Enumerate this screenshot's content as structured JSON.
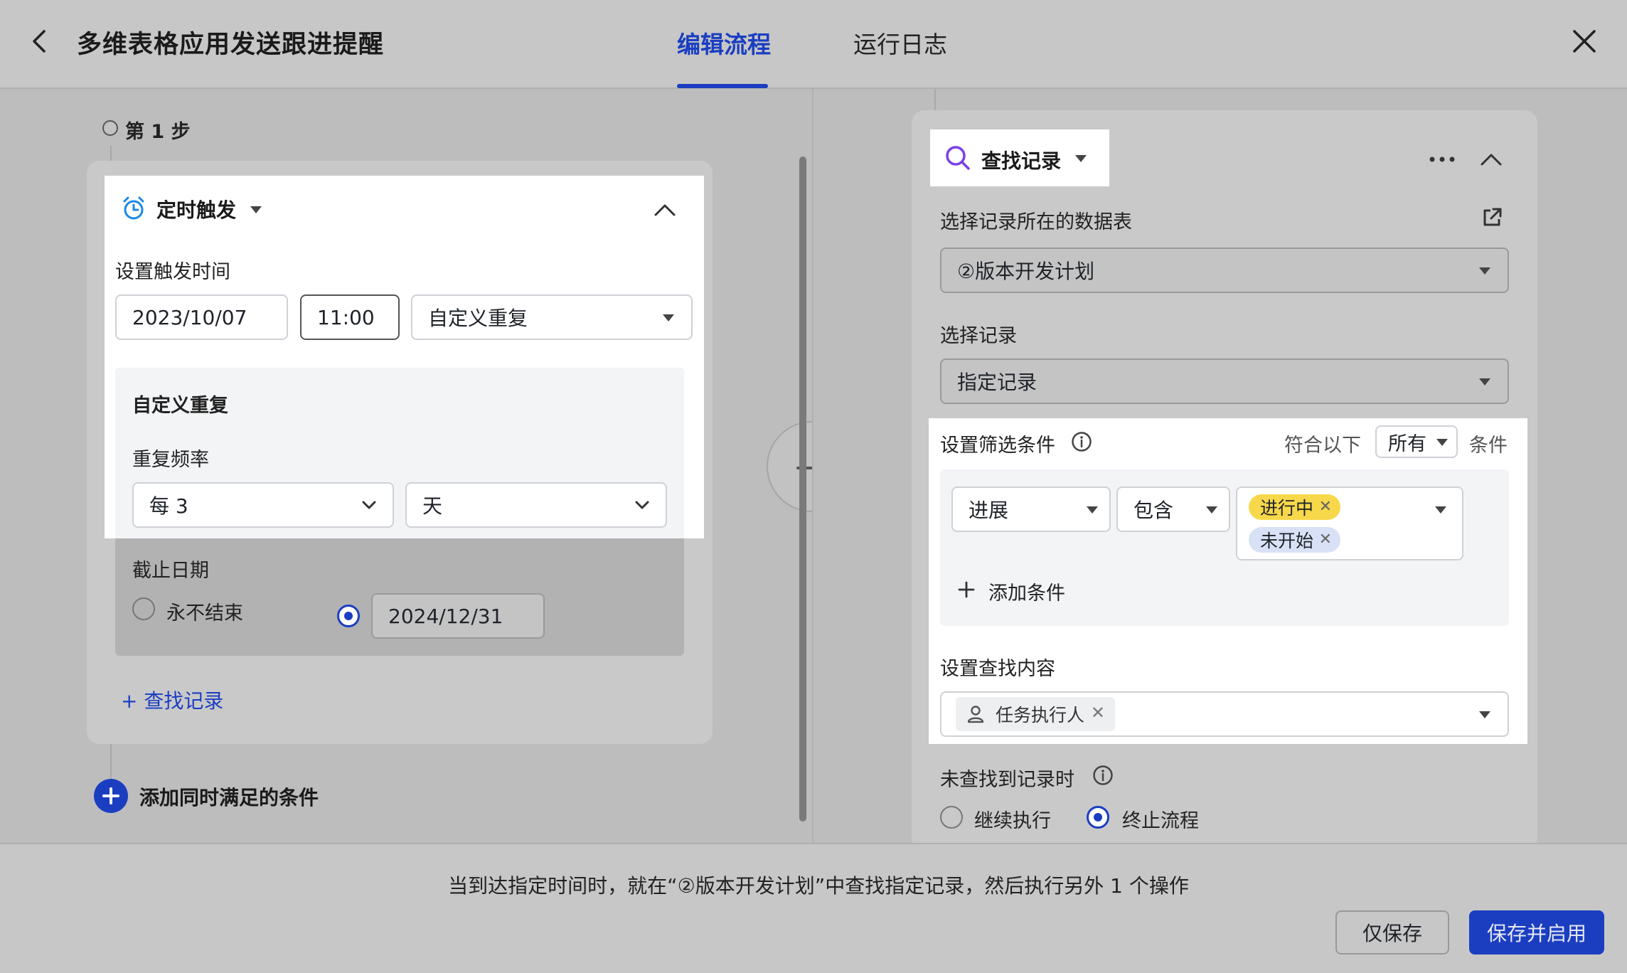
{
  "header": {
    "title": "多维表格应用发送跟进提醒",
    "tabs": [
      {
        "label": "编辑流程",
        "active": true
      },
      {
        "label": "运行日志",
        "active": false
      }
    ]
  },
  "left": {
    "step_label": "第 1 步",
    "trigger": {
      "title": "定时触发",
      "time_label": "设置触发时间",
      "date": "2023/10/07",
      "time": "11:00",
      "repeat_select": "自定义重复",
      "custom": {
        "heading": "自定义重复",
        "freq_label": "重复频率",
        "every": "每 3",
        "unit": "天",
        "end_label": "截止日期",
        "never_end": "永不结束",
        "end_date": "2024/12/31",
        "selected": "end_date"
      },
      "add_find": "+ 查找记录"
    },
    "add_condition": "添加同时满足的条件"
  },
  "right": {
    "title": "查找记录",
    "table_label": "选择记录所在的数据表",
    "table_value": "②版本开发计划",
    "record_label": "选择记录",
    "record_value": "指定记录",
    "filter": {
      "label": "设置筛选条件",
      "match_prefix": "符合以下",
      "match_value": "所有",
      "match_suffix": "条件",
      "field": "进展",
      "operator": "包含",
      "values": [
        "进行中",
        "未开始"
      ],
      "add_condition": "添加条件"
    },
    "content_label": "设置查找内容",
    "content_value": "任务执行人",
    "not_found_label": "未查找到记录时",
    "not_found_options": [
      "继续执行",
      "终止流程"
    ],
    "not_found_selected": "终止流程"
  },
  "footer": {
    "summary": "当到达指定时间时，就在“②版本开发计划”中查找指定记录，然后执行另外 1 个操作",
    "save_only": "仅保存",
    "save_enable": "保存并启用"
  },
  "colors": {
    "accent": "#1b3ec1",
    "tag_yellow": "#f7d84a",
    "tag_blue": "#d8e1f6"
  }
}
